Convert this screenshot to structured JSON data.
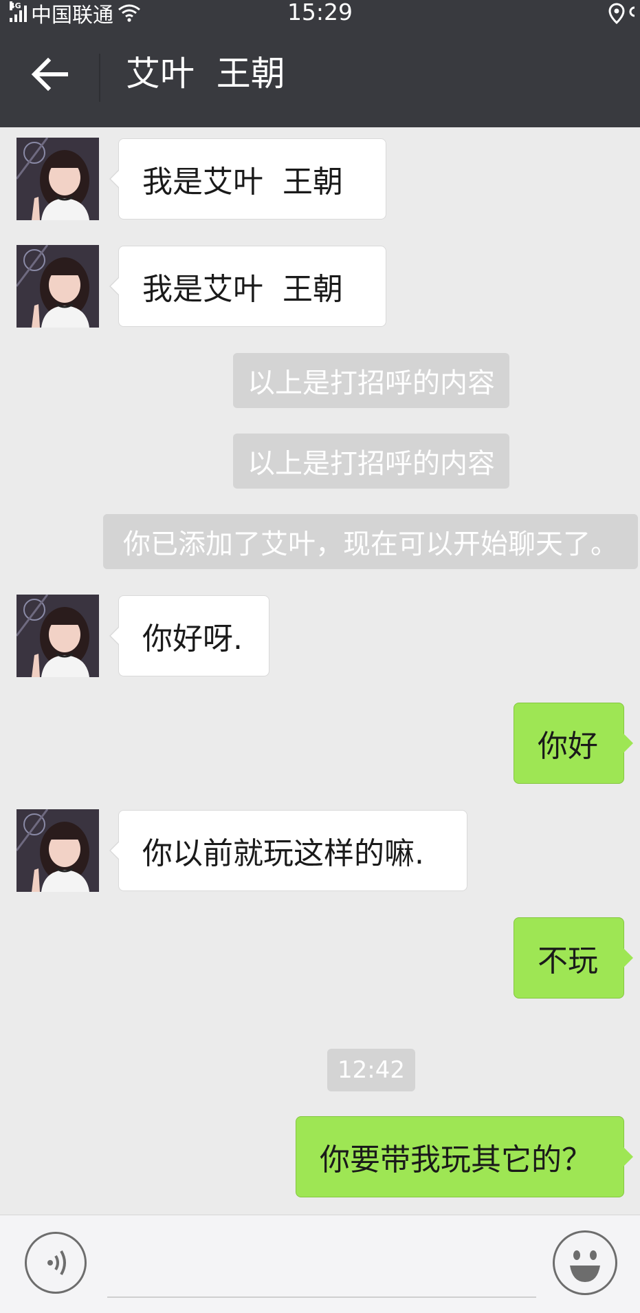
{
  "status_bar": {
    "network": "4G",
    "carrier": "中国联通",
    "time": "15:29"
  },
  "header": {
    "title": "艾叶  王朝"
  },
  "messages": [
    {
      "text": "我是艾叶  王朝"
    },
    {
      "text": "我是艾叶  王朝"
    },
    {
      "text": "以上是打招呼的内容"
    },
    {
      "text": "以上是打招呼的内容"
    },
    {
      "text": "你已添加了艾叶，现在可以开始聊天了。"
    },
    {
      "text": "你好呀."
    },
    {
      "text": "你好"
    },
    {
      "text": "你以前就玩这样的嘛."
    },
    {
      "text": "不玩"
    },
    {
      "text": "12:42"
    },
    {
      "text": "你要带我玩其它的？"
    }
  ],
  "colors": {
    "header_bg": "#393a3f",
    "chat_bg": "#ebebeb",
    "outgoing_bubble": "#9ee654",
    "incoming_bubble": "#ffffff",
    "system_message_bg": "#d4d4d4"
  },
  "icons": [
    "signal-icon",
    "wifi-icon",
    "location-icon",
    "back-arrow-icon",
    "voice-icon",
    "emoji-icon"
  ]
}
